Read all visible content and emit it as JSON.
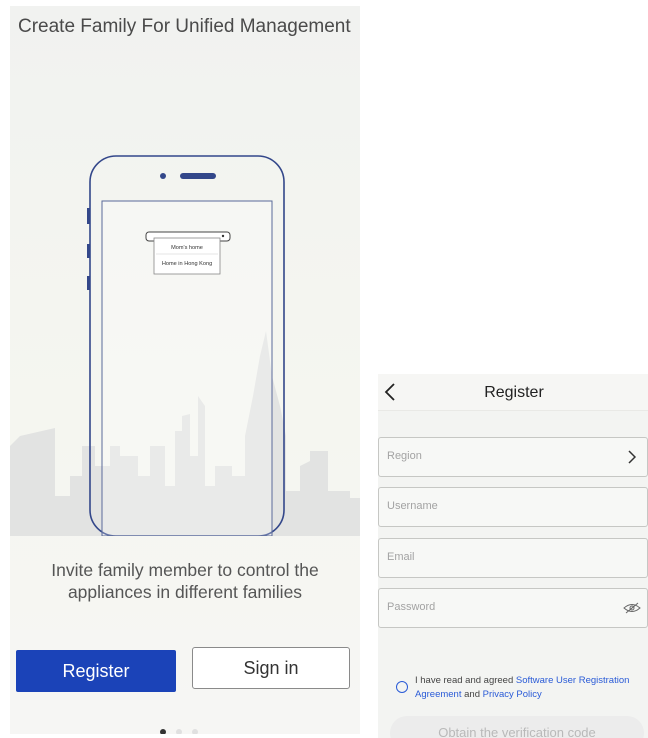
{
  "onboarding": {
    "title": "Create Family For Unified Management",
    "family_card": {
      "line1": "Mom's home",
      "line2": "Home in Hong Kong"
    },
    "description_line1": "Invite family member to control the",
    "description_line2": "appliances in different families",
    "register_label": "Register",
    "signin_label": "Sign in",
    "page_indicator": {
      "count": 3,
      "active": 0
    },
    "colors": {
      "primary": "#1b43b8",
      "illustration_stroke": "#33478a"
    }
  },
  "register": {
    "title": "Register",
    "fields": {
      "region_placeholder": "Region",
      "username_placeholder": "Username",
      "email_placeholder": "Email",
      "password_placeholder": "Password"
    },
    "agreement": {
      "prefix": "I have read and agreed ",
      "link1": "Software User Registration Agreement",
      "and": " and ",
      "link2": "Privacy Policy"
    },
    "verify_label": "Obtain the verification code",
    "colors": {
      "link": "#2a5bd7"
    }
  }
}
